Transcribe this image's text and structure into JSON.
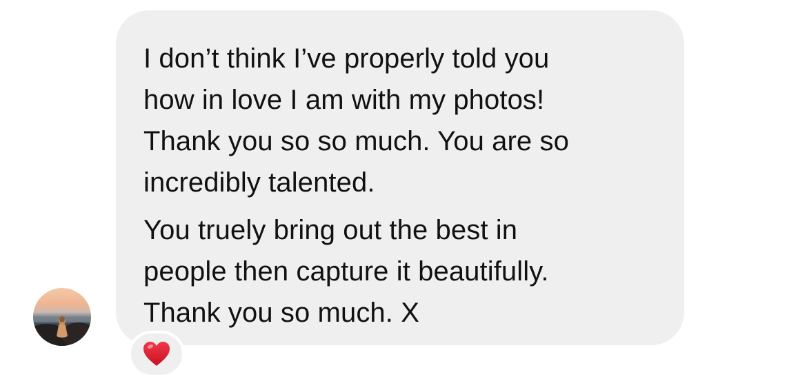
{
  "message": {
    "paragraphs": [
      {
        "lines": [
          "I don’t think I’ve properly told you",
          "how in love I am with my photos!",
          "Thank you so so much. You are so",
          "incredibly talented."
        ]
      },
      {
        "lines": [
          "You truely bring out the best in",
          "people then capture it beautifully.",
          "Thank you so much. X"
        ]
      }
    ],
    "reaction": {
      "icon": "red-heart-icon",
      "color": "#e3182d"
    }
  },
  "sender": {
    "avatar": "profile-photo-icon"
  },
  "colors": {
    "bubble": "#efefef",
    "text": "#111111",
    "background": "#ffffff"
  }
}
